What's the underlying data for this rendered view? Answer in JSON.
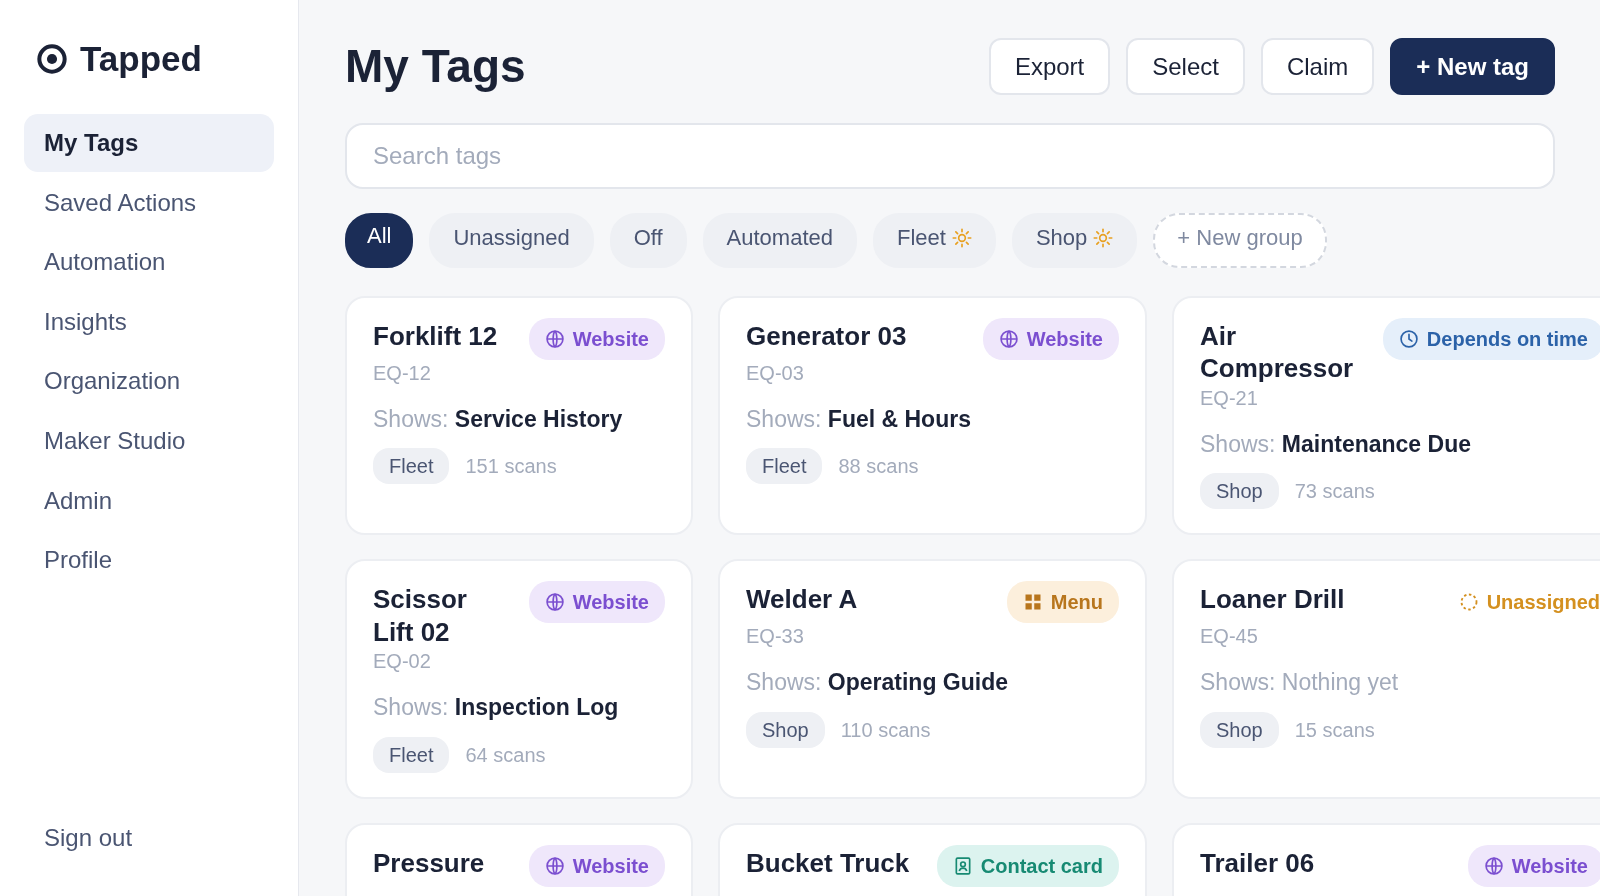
{
  "sidebar": {
    "brand": "Tapped",
    "items": [
      {
        "label": "My Tags",
        "selected": true
      },
      {
        "label": "Saved Actions",
        "selected": false
      },
      {
        "label": "Automation",
        "selected": false
      },
      {
        "label": "Insights",
        "selected": false
      },
      {
        "label": "Organization",
        "selected": false
      },
      {
        "label": "Maker Studio",
        "selected": false
      },
      {
        "label": "Admin",
        "selected": false
      },
      {
        "label": "Profile",
        "selected": false
      }
    ],
    "footer": "Sign out"
  },
  "header": {
    "title": "My Tags",
    "buttons": [
      {
        "label": "Export",
        "kind": "outline"
      },
      {
        "label": "Select",
        "kind": "outline"
      },
      {
        "label": "Claim",
        "kind": "outline"
      },
      {
        "label": "+ New tag",
        "kind": "primary"
      }
    ]
  },
  "search": {
    "placeholder": "Search tags"
  },
  "filters": [
    {
      "label": "All",
      "selected": true,
      "kind": "chip",
      "automated": false
    },
    {
      "label": "Unassigned",
      "selected": false,
      "kind": "chip",
      "automated": false
    },
    {
      "label": "Off",
      "selected": false,
      "kind": "chip",
      "automated": false
    },
    {
      "label": "Automated",
      "selected": false,
      "kind": "chip",
      "automated": false
    },
    {
      "label": "Fleet",
      "selected": false,
      "kind": "chip",
      "automated": true
    },
    {
      "label": "Shop",
      "selected": false,
      "kind": "chip",
      "automated": true
    },
    {
      "label": "+ New group",
      "selected": false,
      "kind": "add",
      "automated": false
    }
  ],
  "tags": [
    {
      "name": "Forklift 12",
      "code": "EQ-12",
      "badge": {
        "label": "Website",
        "kind": "website"
      },
      "shows_label": "Shows:",
      "shows": "Service History",
      "assigned": true,
      "group": "Fleet",
      "scans": "151 scans"
    },
    {
      "name": "Generator 03",
      "code": "EQ-03",
      "badge": {
        "label": "Website",
        "kind": "website"
      },
      "shows_label": "Shows:",
      "shows": "Fuel & Hours",
      "assigned": true,
      "group": "Fleet",
      "scans": "88 scans"
    },
    {
      "name": "Air Compressor",
      "code": "EQ-21",
      "badge": {
        "label": "Depends on time",
        "kind": "time"
      },
      "shows_label": "Shows:",
      "shows": "Maintenance Due",
      "assigned": true,
      "group": "Shop",
      "scans": "73 scans"
    },
    {
      "name": "Scissor Lift 02",
      "code": "EQ-02",
      "badge": {
        "label": "Website",
        "kind": "website"
      },
      "shows_label": "Shows:",
      "shows": "Inspection Log",
      "assigned": true,
      "group": "Fleet",
      "scans": "64 scans"
    },
    {
      "name": "Welder A",
      "code": "EQ-33",
      "badge": {
        "label": "Menu",
        "kind": "menu"
      },
      "shows_label": "Shows:",
      "shows": "Operating Guide",
      "assigned": true,
      "group": "Shop",
      "scans": "110 scans"
    },
    {
      "name": "Loaner Drill",
      "code": "EQ-45",
      "badge": {
        "label": "Unassigned",
        "kind": "unassigned"
      },
      "shows_label": "Shows:",
      "shows": "Nothing yet",
      "assigned": false,
      "group": "Shop",
      "scans": "15 scans"
    },
    {
      "name": "Pressure",
      "badge": {
        "label": "Website",
        "kind": "website"
      }
    },
    {
      "name": "Bucket Truck",
      "badge": {
        "label": "Contact card",
        "kind": "contact"
      }
    },
    {
      "name": "Trailer 06",
      "badge": {
        "label": "Website",
        "kind": "website"
      }
    }
  ]
}
